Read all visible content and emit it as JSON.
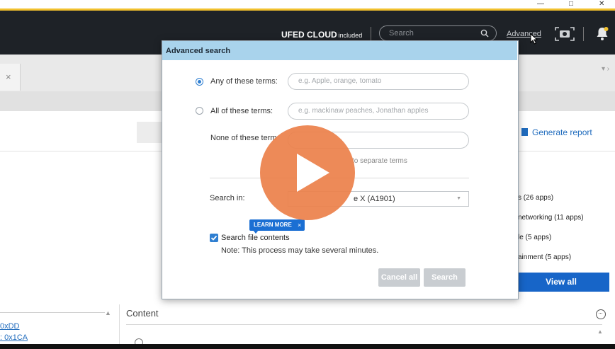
{
  "window_controls": [
    "—",
    "□",
    "✕"
  ],
  "header": {
    "brand": "UFED CLOUD",
    "brand_suffix": "included",
    "search_placeholder": "Search",
    "advanced_link": "Advanced"
  },
  "tab_close": "×",
  "toolbar": {
    "generate_report": "Generate report"
  },
  "apps": {
    "rows": [
      "s (26 apps)",
      "networking (11 apps)",
      "le (5 apps)",
      "ainment (5 apps)"
    ],
    "view_all": "View all"
  },
  "left_panel": {
    "links": [
      "0xDD",
      ": 0x1CA"
    ]
  },
  "content": {
    "label": "Content"
  },
  "dialog": {
    "title": "Advanced search",
    "any_label": "Any of these terms:",
    "any_placeholder": "e.g. Apple, orange, tomato",
    "all_label": "All of these terms:",
    "all_placeholder": "e.g. mackinaw peaches, Jonathan apples",
    "none_label": "None of these term",
    "hint": "to separate terms",
    "search_in_label": "Search in:",
    "search_in_value": "e X (A1901)",
    "learn_more": "LEARN MORE",
    "learn_close": "×",
    "search_file_contents": "Search file contents",
    "note": "Note: This process may take several minutes.",
    "cancel_all": "Cancel all",
    "search_button": "Search"
  },
  "colors": {
    "header_bg": "#1e2227",
    "accent_yellow": "#f2c12e",
    "dialog_title_bg": "#a9d3ec",
    "link_blue": "#1f6bbd",
    "view_all_bg": "#1765c8",
    "play_overlay": "#ec804a"
  }
}
